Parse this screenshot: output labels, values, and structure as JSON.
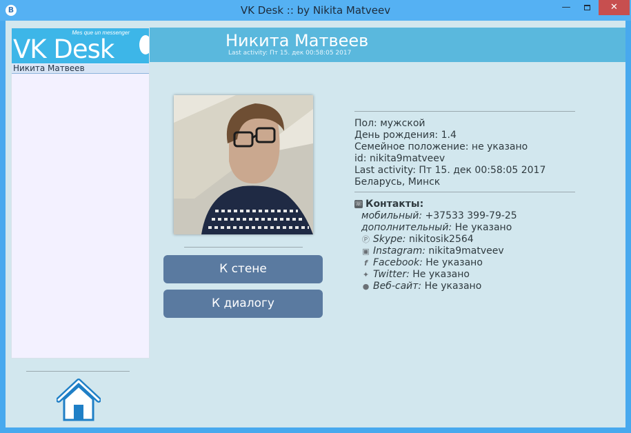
{
  "window": {
    "title": "VK Desk :: by Nikita Matveev",
    "app_icon": "B",
    "minimize": "—",
    "close": "✕"
  },
  "logo": {
    "tagline": "Mes que un messenger",
    "text": "VK Desk"
  },
  "sidebar": {
    "items": [
      {
        "label": "Никита Матвеев"
      }
    ]
  },
  "profile": {
    "name": "Никита Матвеев",
    "last_activity_header": "Last activity: Пт 15. дек 00:58:05 2017",
    "info": [
      "Пол: мужской",
      "День рождения: 1.4",
      "Семейное положение: не указано",
      "id: nikita9matveev",
      "Last activity: Пт 15. дек 00:58:05 2017",
      "Беларусь, Минск"
    ]
  },
  "buttons": {
    "wall": "К  стене",
    "dialog": "К  диалогу"
  },
  "contacts": {
    "title": "Контакты:",
    "mobile": {
      "label": "мобильный:",
      "value": " +37533 399-79-25"
    },
    "additional": {
      "label": "дополнительный:",
      "value": " Не указано"
    },
    "skype": {
      "label": "Skype:",
      "value": " nikitosik2564",
      "icon": "skype-icon"
    },
    "instagram": {
      "label": "Instagram:",
      "value": " nikita9matveev",
      "icon": "instagram-icon"
    },
    "facebook": {
      "label": "Facebook:",
      "value": " Не указано",
      "icon": "facebook-icon"
    },
    "twitter": {
      "label": "Twitter:",
      "value": " Не указано",
      "icon": "twitter-icon"
    },
    "website": {
      "label": "Веб-сайт:",
      "value": " Не указано",
      "icon": "globe-icon"
    }
  },
  "colors": {
    "titlebar": "#55b1f3",
    "header": "#5ab8dd",
    "button": "#5a7aa0",
    "background": "#d2e7ee"
  }
}
